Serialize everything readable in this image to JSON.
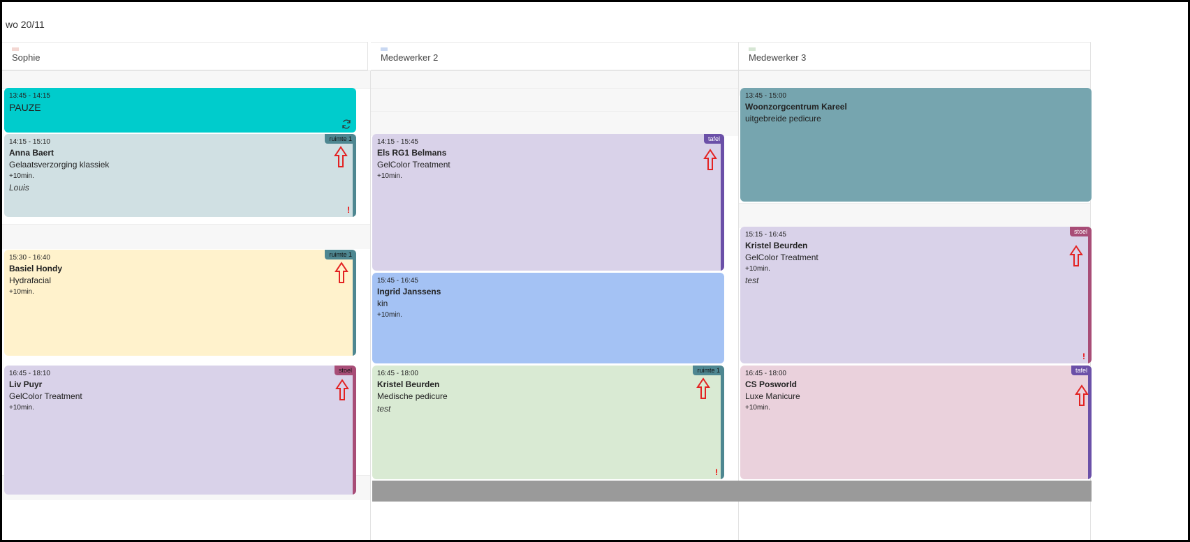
{
  "header": {
    "date": "wo 20/11"
  },
  "columns": [
    {
      "name": "Sophie",
      "swatch": "#f3d7d2"
    },
    {
      "name": "Medewerker 2",
      "swatch": "#c9d8f2"
    },
    {
      "name": "Medewerker 3",
      "swatch": "#d6e6d4"
    }
  ],
  "appointments": {
    "sophie_pauze": {
      "time": "13:45 - 14:15",
      "label": "PAUZE",
      "icon": "sync-icon"
    },
    "sophie_anna": {
      "time": "14:15 - 15:10",
      "client": "Anna Baert",
      "service": "Gelaatsverzorging klassiek",
      "extra": "+10min.",
      "note": "Louis",
      "resource": "ruimte 1",
      "warn": "!"
    },
    "sophie_basiel": {
      "time": "15:30 - 16:40",
      "client": "Basiel Hondy",
      "service": "Hydrafacial",
      "extra": "+10min.",
      "resource": "ruimte 1"
    },
    "sophie_liv": {
      "time": "16:45 - 18:10",
      "client": "Liv Puyr",
      "service": "GelColor Treatment",
      "extra": "+10min.",
      "resource": "stoel"
    },
    "m2_els": {
      "time": "14:15 - 15:45",
      "client": "Els RG1 Belmans",
      "service": "GelColor Treatment",
      "extra": "+10min.",
      "resource": "tafel"
    },
    "m2_ingrid": {
      "time": "15:45 - 16:45",
      "client": "Ingrid Janssens",
      "service": "kin",
      "extra": "+10min."
    },
    "m2_kristel": {
      "time": "16:45 - 18:00",
      "client": "Kristel Beurden",
      "service": "Medische pedicure",
      "note": "test",
      "resource": "ruimte 1",
      "warn": "!"
    },
    "m3_woon": {
      "time": "13:45 - 15:00",
      "client": "Woonzorgcentrum Kareel",
      "service": "uitgebreide pedicure"
    },
    "m3_kristel": {
      "time": "15:15 - 16:45",
      "client": "Kristel Beurden",
      "service": "GelColor Treatment",
      "extra": "+10min.",
      "note": "test",
      "resource": "stoel",
      "warn": "!"
    },
    "m3_cs": {
      "time": "16:45 - 18:00",
      "client": "CS Posworld",
      "service": "Luxe Manicure",
      "extra": "+10min.",
      "resource": "tafel"
    }
  },
  "colors": {
    "pauze": "#00cccc",
    "anna": "#d0e0e3",
    "basiel": "#fff2cc",
    "purple": "#d9d2e9",
    "blue": "#a4c2f4",
    "green": "#d9ead3",
    "teal": "#76a5af",
    "pink": "#ead1dc",
    "res_ruimte": "#4e8791",
    "res_tafel": "#6b50a8",
    "res_stoel": "#a84d77",
    "arrow": "#e32222"
  }
}
